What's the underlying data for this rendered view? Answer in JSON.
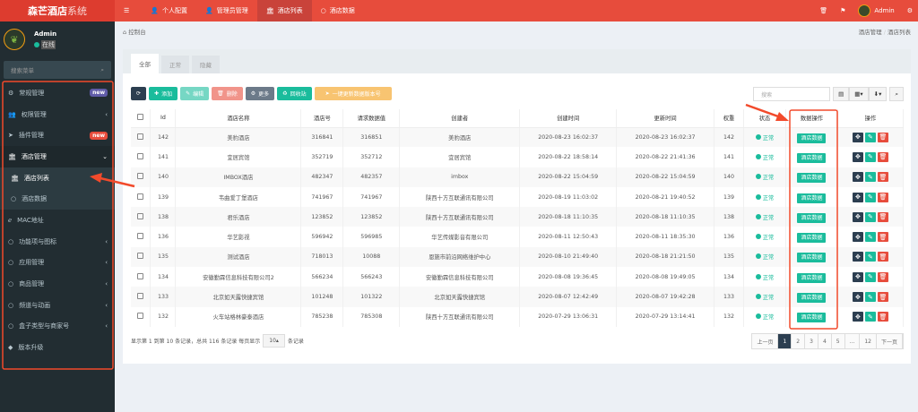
{
  "header": {
    "logo_bold": "森芒酒店",
    "logo_light": "系统",
    "nav": [
      {
        "icon": "☰",
        "label": ""
      },
      {
        "icon": "👤",
        "label": "个人配置"
      },
      {
        "icon": "👤",
        "label": "管理员管理"
      },
      {
        "icon": "🏛",
        "label": "酒店列表",
        "active": true
      },
      {
        "icon": "○",
        "label": "酒店数据"
      }
    ],
    "user": "Admin"
  },
  "sidebar": {
    "user": "Admin",
    "status": "在线",
    "search_placeholder": "搜索菜单",
    "items": [
      {
        "label": "常规管理",
        "badge": "new",
        "badge_color": "#605ca8"
      },
      {
        "label": "权限管理",
        "arrow": "‹"
      },
      {
        "label": "插件管理",
        "badge": "new",
        "badge_color": "#e74c3c"
      },
      {
        "label": "酒店管理",
        "arrow": "⌄"
      },
      {
        "label": "酒店列表"
      },
      {
        "label": "酒店数据"
      },
      {
        "label": "MAC地址"
      },
      {
        "label": "功能项与图标",
        "arrow": "‹"
      },
      {
        "label": "应用管理",
        "arrow": "‹"
      },
      {
        "label": "商品管理",
        "arrow": "‹"
      },
      {
        "label": "频道与动画",
        "arrow": "‹"
      },
      {
        "label": "盒子类型与商家号",
        "arrow": "‹"
      },
      {
        "label": "版本升级"
      }
    ]
  },
  "breadcrumb": {
    "home": "控制台",
    "path1": "酒店管理",
    "sep": "/",
    "path2": "酒店列表"
  },
  "tabs": [
    "全部",
    "正常",
    "隐藏"
  ],
  "toolbar": {
    "refresh": "⟳",
    "add": "添加",
    "edit": "编辑",
    "delete": "删除",
    "more": "更多",
    "recycle": "回收站",
    "update_version": "一键更新数据版本号",
    "search_placeholder": "搜索"
  },
  "table": {
    "columns": [
      "Id",
      "酒店名称",
      "酒店号",
      "请求数据值",
      "创建者",
      "创建时间",
      "更新时间",
      "权重",
      "状态",
      "数据操作",
      "操作"
    ],
    "rows": [
      [
        "142",
        "美豹酒店",
        "316841",
        "316851",
        "美豹酒店",
        "2020-08-23 16:02:37",
        "2020-08-23 16:02:37",
        "142",
        "正常"
      ],
      [
        "141",
        "宜居宾馆",
        "352719",
        "352712",
        "宜居宾馆",
        "2020-08-22 18:58:14",
        "2020-08-22 21:41:36",
        "141",
        "正常"
      ],
      [
        "140",
        "IMBOX酒店",
        "482347",
        "482357",
        "imbox",
        "2020-08-22 15:04:59",
        "2020-08-22 15:04:59",
        "140",
        "正常"
      ],
      [
        "139",
        "韦曲爱丁堡酒店",
        "741967",
        "741967",
        "陕西十方互联通讯有限公司",
        "2020-08-19 11:03:02",
        "2020-08-21 19:40:52",
        "139",
        "正常"
      ],
      [
        "138",
        "君乐酒店",
        "123852",
        "123852",
        "陕西十方互联通讯有限公司",
        "2020-08-18 11:10:35",
        "2020-08-18 11:10:35",
        "138",
        "正常"
      ],
      [
        "136",
        "华艺影视",
        "596942",
        "596985",
        "华艺传媒影音有限公司",
        "2020-08-11 12:50:43",
        "2020-08-11 18:35:30",
        "136",
        "正常"
      ],
      [
        "135",
        "测试酒店",
        "718013",
        "10088",
        "恩施市前沿网络维护中心",
        "2020-08-10 21:49:40",
        "2020-08-18 21:21:50",
        "135",
        "正常"
      ],
      [
        "134",
        "安徽勤霖信息科技有限公司2",
        "566234",
        "566243",
        "安徽勤霖信息科技有限公司",
        "2020-08-08 19:36:45",
        "2020-08-08 19:49:05",
        "134",
        "正常"
      ],
      [
        "133",
        "北京如天露快捷宾馆",
        "101248",
        "101322",
        "北京如天露快捷宾馆",
        "2020-08-07 12:42:49",
        "2020-08-07 19:42:28",
        "133",
        "正常"
      ],
      [
        "132",
        "火车站格林豪泰酒店",
        "785238",
        "785308",
        "陕西十方互联通讯有限公司",
        "2020-07-29 13:06:31",
        "2020-07-29 13:14:41",
        "132",
        "正常"
      ]
    ],
    "data_button": "酒店数据"
  },
  "footer": {
    "summary": "显示第 1 到第 10 条记录，总共 116 条记录 每页显示",
    "page_size": "10▴",
    "suffix": "条记录"
  },
  "pagination": [
    "上一页",
    "1",
    "2",
    "3",
    "4",
    "5",
    "...",
    "12",
    "下一页"
  ],
  "colors": {
    "header": "#e74c3c",
    "sidebar": "#222d32",
    "success": "#1abc9c",
    "danger": "#e74c3c",
    "annotation": "#f24a2b"
  }
}
